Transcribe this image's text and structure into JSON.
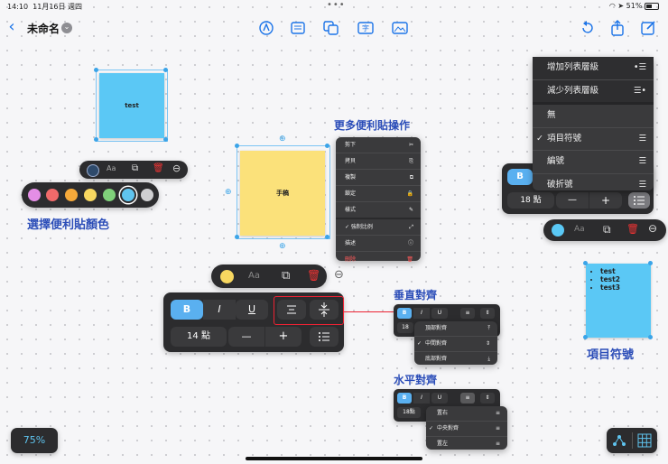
{
  "status": {
    "time": "14:10",
    "date": "11月16日 週四",
    "battery": "51%"
  },
  "header": {
    "title": "未命名",
    "back": "‹",
    "chevron": "⌄"
  },
  "zoom": "75%",
  "notes": {
    "blue_text": "test",
    "yellow_text": "手稿",
    "list_items": [
      "test",
      "test2",
      "test3"
    ]
  },
  "annotations": {
    "more_ops": "更多便利貼操作",
    "pick_color": "選擇便利貼顏色",
    "vertical_align": "垂直對齊",
    "horizontal_align": "水平對齊",
    "bullets": "項目符號"
  },
  "context_menu": [
    "剪下",
    "拷貝",
    "複製",
    "鎖定",
    "樣式",
    "✓ 強制比例",
    "描述",
    "刪除"
  ],
  "format_toolbar": {
    "bold": "B",
    "italic": "I",
    "underline": "U",
    "size": "14 點",
    "minus": "—",
    "plus": "+",
    "aa": "Aa"
  },
  "list_menu": {
    "items": [
      "增加列表層級",
      "減少列表層級",
      "無",
      "項目符號",
      "編號",
      "破折號"
    ],
    "checked": "✓",
    "size": "18 點",
    "bold": "B",
    "minus": "—",
    "plus": "+",
    "aa": "Aa"
  },
  "small_v_menu": {
    "size": "18",
    "items": [
      "頂部對齊",
      "中間對齊",
      "底部對齊"
    ]
  },
  "small_h_menu": {
    "size": "18點",
    "items": [
      "置右",
      "中央對齊",
      "置左"
    ]
  },
  "small_bar": {
    "bold": "B",
    "italic": "I",
    "underline": "U"
  },
  "colors": [
    "#e48ee6",
    "#f06a6a",
    "#f6a93a",
    "#f7d760",
    "#7fd07a",
    "#5fc4ef",
    "#cfcfd1"
  ]
}
